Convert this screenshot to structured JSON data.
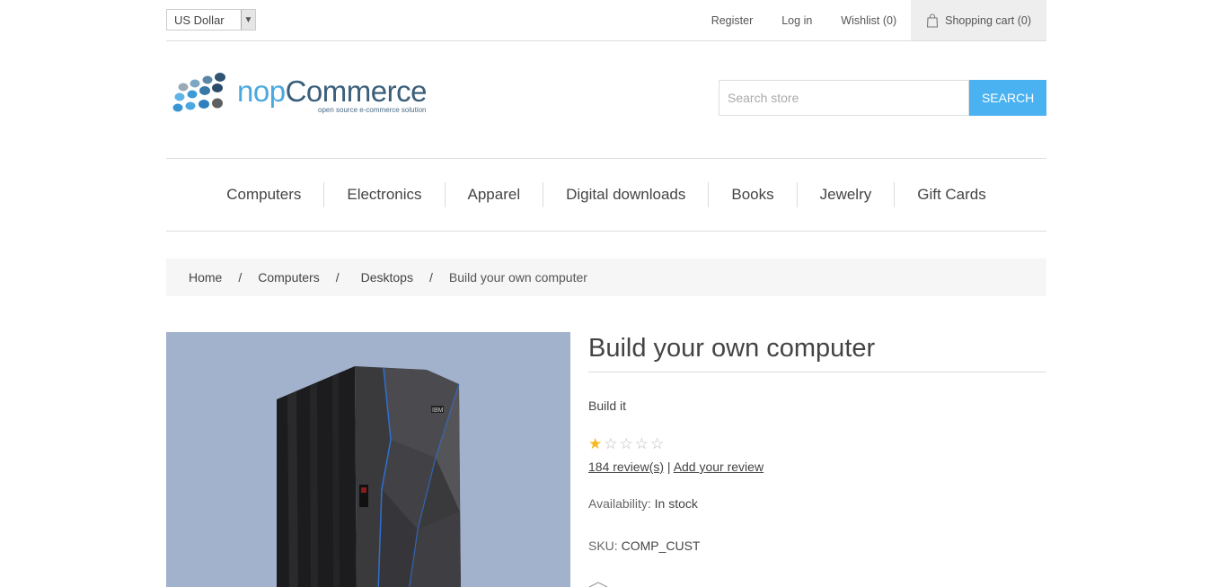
{
  "header": {
    "currency": "US Dollar",
    "links": {
      "register": "Register",
      "login": "Log in",
      "wishlist": "Wishlist (0)",
      "cart": "Shopping cart (0)"
    }
  },
  "logo": {
    "part1": "nop",
    "part2": "Commerce",
    "tagline": "open source e-commerce solution"
  },
  "search": {
    "placeholder": "Search store",
    "button": "SEARCH"
  },
  "menu": {
    "items": [
      "Computers",
      "Electronics",
      "Apparel",
      "Digital downloads",
      "Books",
      "Jewelry",
      "Gift Cards"
    ]
  },
  "breadcrumb": {
    "home": "Home",
    "computers": "Computers",
    "desktops": "Desktops",
    "current": "Build your own computer",
    "separator": "/"
  },
  "product": {
    "title": "Build your own computer",
    "short_description": "Build it",
    "rating": 1,
    "rating_max": 5,
    "reviews_link": "184 review(s)",
    "reviews_separator": "|",
    "add_review": "Add your review",
    "availability_label": "Availability:",
    "availability_value": "In stock",
    "sku_label": "SKU:",
    "sku_value": "COMP_CUST",
    "image_background": "#a2b1cc",
    "image_brand_text": "IBM"
  },
  "colors": {
    "accent": "#4ab2f1",
    "star_on": "#f5b820",
    "star_off": "#bbbbbb"
  }
}
